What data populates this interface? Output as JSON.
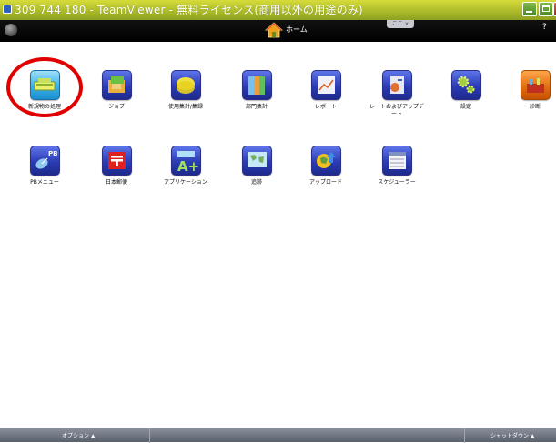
{
  "window": {
    "title": "309 744 180 - TeamViewer - 無料ライセンス(商用以外の用途のみ)"
  },
  "header": {
    "home_label": "ホーム",
    "tab_toggle_label": "ここ ∨",
    "help_label": "?"
  },
  "tiles": [
    {
      "label": "新規物の処理",
      "icon": "new-items-icon"
    },
    {
      "label": "ジョブ",
      "icon": "job-icon"
    },
    {
      "label": "使用集計/集録",
      "icon": "usage-report-icon"
    },
    {
      "label": "部門集計",
      "icon": "department-report-icon"
    },
    {
      "label": "レポート",
      "icon": "report-chart-icon"
    },
    {
      "label": "レートおよびアップデート",
      "icon": "rate-update-icon"
    },
    {
      "label": "設定",
      "icon": "settings-gears-icon"
    },
    {
      "label": "診断",
      "icon": "diagnostics-toolbox-icon"
    },
    {
      "label": "PBメニュー",
      "icon": "pb-menu-satellite-icon"
    },
    {
      "label": "日本郵便",
      "icon": "japan-post-icon"
    },
    {
      "label": "アプリケーション",
      "icon": "applications-icon"
    },
    {
      "label": "追跡",
      "icon": "tracking-map-icon"
    },
    {
      "label": "アップロード",
      "icon": "upload-globe-icon"
    },
    {
      "label": "スケジューラー",
      "icon": "scheduler-icon"
    }
  ],
  "footer": {
    "options_label": "オプション ▲",
    "shutdown_label": "シャットダウン ▲"
  },
  "colors": {
    "title_bar": "#a9b82a",
    "header_bg": "#000000",
    "tile_blue": "#2a3bb4",
    "tile_orange": "#e06a10",
    "highlight": "#e00000"
  }
}
